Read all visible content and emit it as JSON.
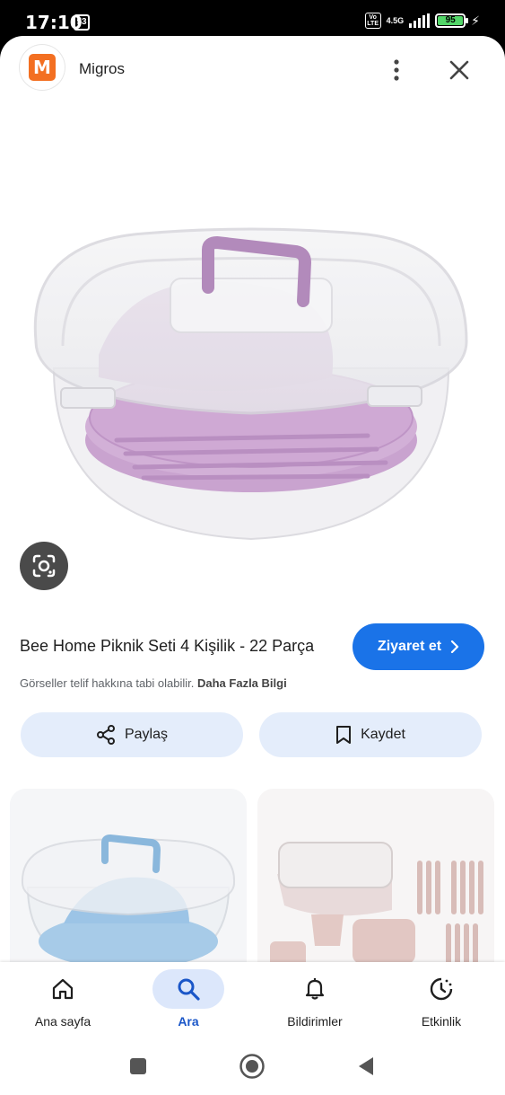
{
  "status_bar": {
    "time": "17:10",
    "notification_count": "53",
    "network_badge": "Vo LTE",
    "network_type": "4.5G",
    "battery": "95"
  },
  "header": {
    "site_name": "Migros",
    "logo_letter": "M",
    "logo_color": "#f36f21"
  },
  "product": {
    "title": "Bee Home Piknik Seti 4 Kişilik - 22 Parça",
    "visit_label": "Ziyaret et",
    "copyright_text": "Görseller telif hakkına tabi olabilir.",
    "more_info_link": "Daha Fazla Bilgi"
  },
  "actions": {
    "share_label": "Paylaş",
    "save_label": "Kaydet"
  },
  "bottom_nav": {
    "items": [
      {
        "label": "Ana sayfa",
        "icon": "home-icon",
        "active": false
      },
      {
        "label": "Ara",
        "icon": "search-icon",
        "active": true
      },
      {
        "label": "Bildirimler",
        "icon": "bell-icon",
        "active": false
      },
      {
        "label": "Etkinlik",
        "icon": "activity-icon",
        "active": false
      }
    ]
  },
  "colors": {
    "accent": "#1a73e8",
    "action_bg": "#e4edfb",
    "product_purple": "#c9a3cf"
  }
}
